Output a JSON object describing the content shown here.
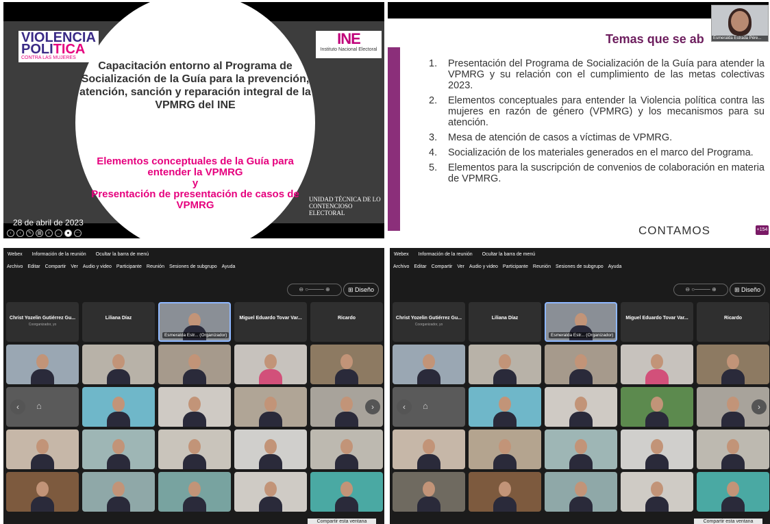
{
  "slide1": {
    "logo_line1": "VIOLENCIA",
    "logo_line2a": "POLI",
    "logo_line2b": "TICA",
    "logo_sub": "CONTRA LAS MUJERES",
    "ine_logo": "INE",
    "ine_sub": "Instituto Nacional Electoral",
    "title": "Capacitación entorno al Programa de Socialización de la Guía para la prevención, atención, sanción y reparación integral de la VPMRG del INE",
    "sub1": "Elementos conceptuales de la Guía para entender la VPMRG",
    "sub2": "y",
    "sub3": "Presentación de presentación de casos de VPMRG",
    "unit": "UNIDAD TÉCNICA DE LO CONTENCIOSO ELECTORAL",
    "date": "28 de abril de 2023"
  },
  "slide2": {
    "title": "Temas que se ab",
    "cam_label": "Esmeralda Estrada Pére...",
    "items": [
      {
        "n": "1.",
        "text": "Presentación del Programa de Socialización de la Guía para atender la VPMRG y su relación con el cumplimiento de las metas colectivas 2023."
      },
      {
        "n": "2.",
        "text": "Elementos conceptuales para entender la Violencia política contra las mujeres en razón de género (VPMRG) y los mecanismos para su atención."
      },
      {
        "n": "3.",
        "text": "Mesa de atención de casos a víctimas de VPMRG."
      },
      {
        "n": "4.",
        "text": "Socialización de los materiales generados en el marco del Programa."
      },
      {
        "n": "5.",
        "text": "Elementos para la suscripción de convenios de colaboración en materia de VPMRG."
      }
    ],
    "footer": "CONTAMOS",
    "badge": "+154"
  },
  "webex": {
    "app": "Webex",
    "info": "Información de la reunión",
    "hide": "Ocultar la barra de menú",
    "menu": [
      "Archivo",
      "Editar",
      "Compartir",
      "Ver",
      "Audio y video",
      "Participante",
      "Reunión",
      "Sesiones de subgrupo",
      "Ayuda"
    ],
    "layout": "Diseño",
    "share": "Compartir esta ventana",
    "p1": "Christ Yozelin Gutiérrez Gu...",
    "p1_sub": "Coorganizador, yo",
    "p2": "Liliana Díaz",
    "p3_left": "Esmeralda Estr... (Organizador)",
    "p3_right": "Esmeralda Estr... (Organizador)",
    "p4": "Miguel Eduardo Tovar Var...",
    "p5": "Ricardo"
  }
}
